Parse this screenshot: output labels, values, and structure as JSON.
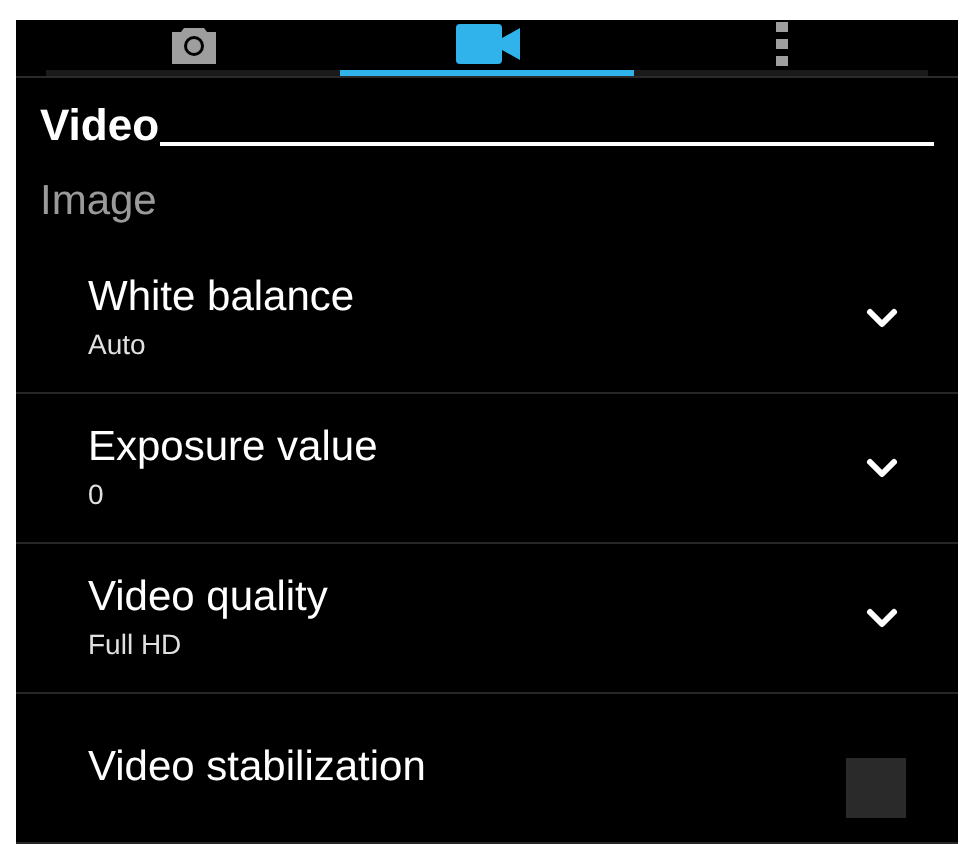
{
  "tabs": [
    {
      "kind": "photo",
      "selected": false
    },
    {
      "kind": "video",
      "selected": true
    },
    {
      "kind": "more",
      "selected": false
    }
  ],
  "section": "Video",
  "group": "Image",
  "settings": [
    {
      "kind": "dropdown",
      "label": "White balance",
      "value": "Auto"
    },
    {
      "kind": "dropdown",
      "label": "Exposure value",
      "value": "0"
    },
    {
      "kind": "dropdown",
      "label": "Video quality",
      "value": "Full HD"
    },
    {
      "kind": "checkbox",
      "label": "Video stabilization",
      "checked": false
    }
  ]
}
